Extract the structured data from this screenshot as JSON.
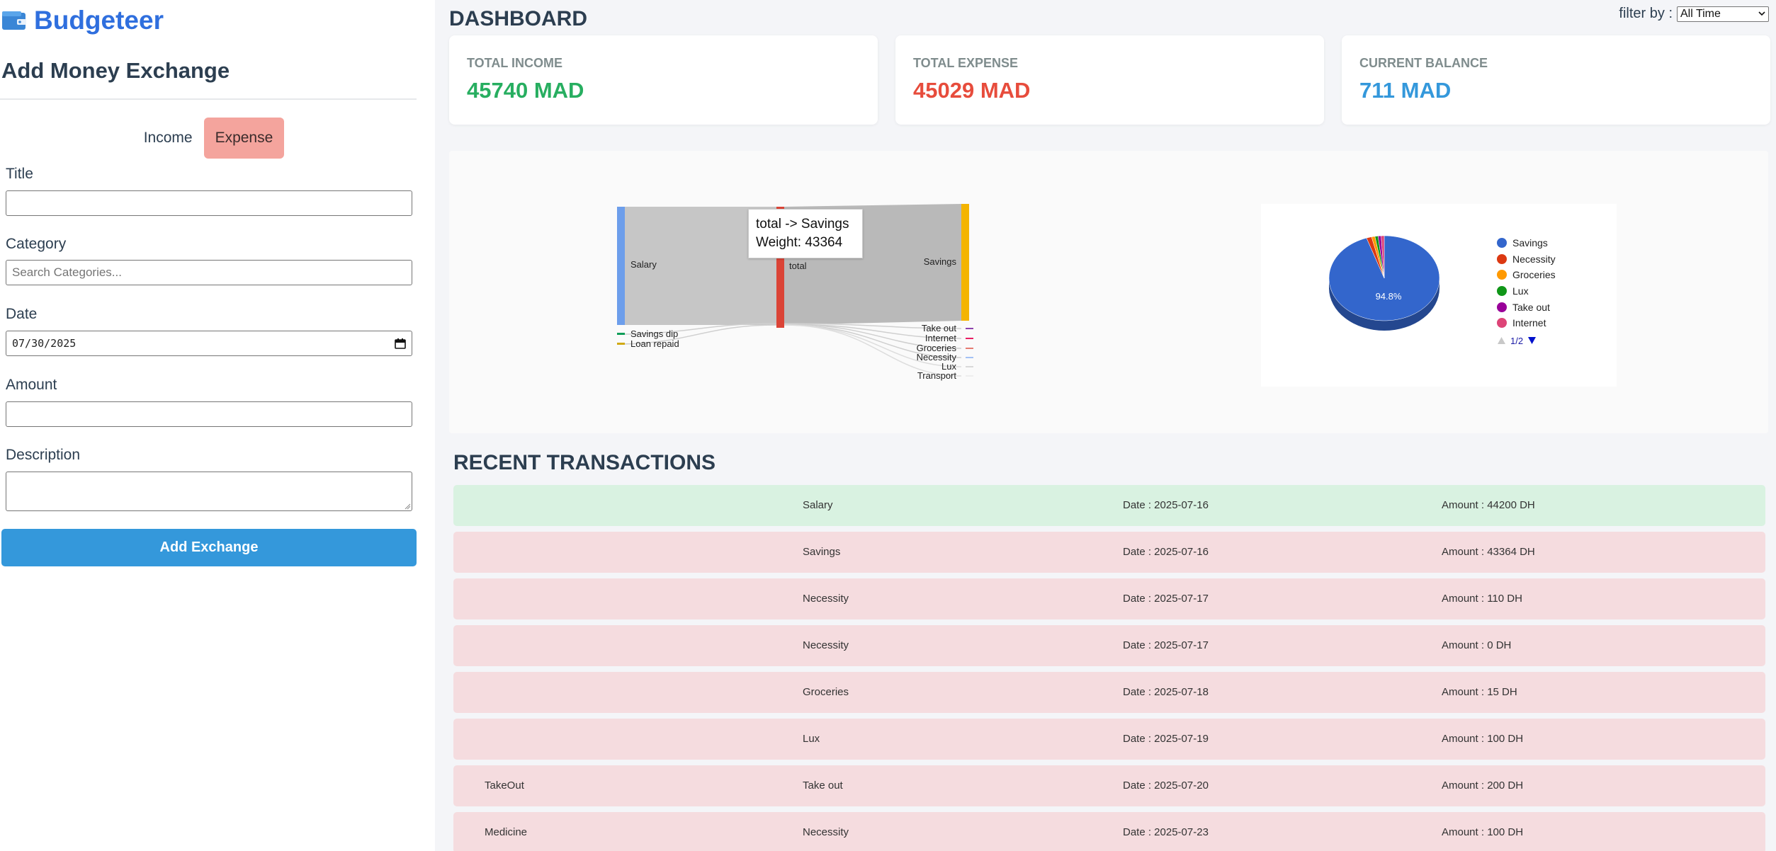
{
  "app": {
    "name": "Budgeteer",
    "logo_icon": "wallet-icon",
    "brand_color": "#2f6fde"
  },
  "form": {
    "title": "Add Money Exchange",
    "type_options": [
      {
        "label": "Income",
        "active": false
      },
      {
        "label": "Expense",
        "active": true
      }
    ],
    "title_label": "Title",
    "title_value": "",
    "category_label": "Category",
    "category_placeholder": "Search Categories...",
    "date_label": "Date",
    "date_value": "07/30/2025",
    "amount_label": "Amount",
    "amount_value": "",
    "description_label": "Description",
    "description_value": "",
    "submit_label": "Add Exchange"
  },
  "dashboard": {
    "title": "DASHBOARD",
    "filter_label": "filter by :",
    "filter_value": "All Time",
    "cards": [
      {
        "label": "TOTAL INCOME",
        "value": "45740 MAD",
        "color": "#27ae60"
      },
      {
        "label": "TOTAL EXPENSE",
        "value": "45029 MAD",
        "color": "#e74c3c"
      },
      {
        "label": "CURRENT BALANCE",
        "value": "711 MAD",
        "color": "#3498db"
      }
    ]
  },
  "sankey": {
    "nodes_left": [
      "Salary",
      "Savings dip",
      "Loan repaid"
    ],
    "node_center": "total",
    "nodes_right": [
      "Savings",
      "Take out",
      "Internet",
      "Groceries",
      "Necessity",
      "Lux",
      "Transport"
    ],
    "tooltip": {
      "line1": "total -> Savings",
      "line2": "Weight: 43364"
    }
  },
  "chart_data": {
    "type": "pie",
    "categories": [
      "Savings",
      "Necessity",
      "Groceries",
      "Lux",
      "Take out",
      "Internet"
    ],
    "values": [
      94.8,
      1.5,
      1.0,
      0.9,
      0.9,
      0.9
    ],
    "slice_label": "94.8%",
    "colors": [
      "#3366cc",
      "#dc3912",
      "#ff9900",
      "#109618",
      "#990099",
      "#dd4477"
    ],
    "legend_placement": "right",
    "legend_pager": "1/2"
  },
  "transactions": {
    "title": "RECENT TRANSACTIONS",
    "rows": [
      {
        "kind": "income",
        "description": "",
        "category": "Salary",
        "date": "Date : 2025-07-16",
        "amount": "Amount : 44200 DH"
      },
      {
        "kind": "expense",
        "description": "",
        "category": "Savings",
        "date": "Date : 2025-07-16",
        "amount": "Amount : 43364 DH"
      },
      {
        "kind": "expense",
        "description": "",
        "category": "Necessity",
        "date": "Date : 2025-07-17",
        "amount": "Amount : 110 DH"
      },
      {
        "kind": "expense",
        "description": "",
        "category": "Necessity",
        "date": "Date : 2025-07-17",
        "amount": "Amount : 0 DH"
      },
      {
        "kind": "expense",
        "description": "",
        "category": "Groceries",
        "date": "Date : 2025-07-18",
        "amount": "Amount : 15 DH"
      },
      {
        "kind": "expense",
        "description": "",
        "category": "Lux",
        "date": "Date : 2025-07-19",
        "amount": "Amount : 100 DH"
      },
      {
        "kind": "expense",
        "description": "TakeOut",
        "category": "Take out",
        "date": "Date : 2025-07-20",
        "amount": "Amount : 200 DH"
      },
      {
        "kind": "expense",
        "description": "Medicine",
        "category": "Necessity",
        "date": "Date : 2025-07-23",
        "amount": "Amount : 100 DH"
      }
    ]
  }
}
